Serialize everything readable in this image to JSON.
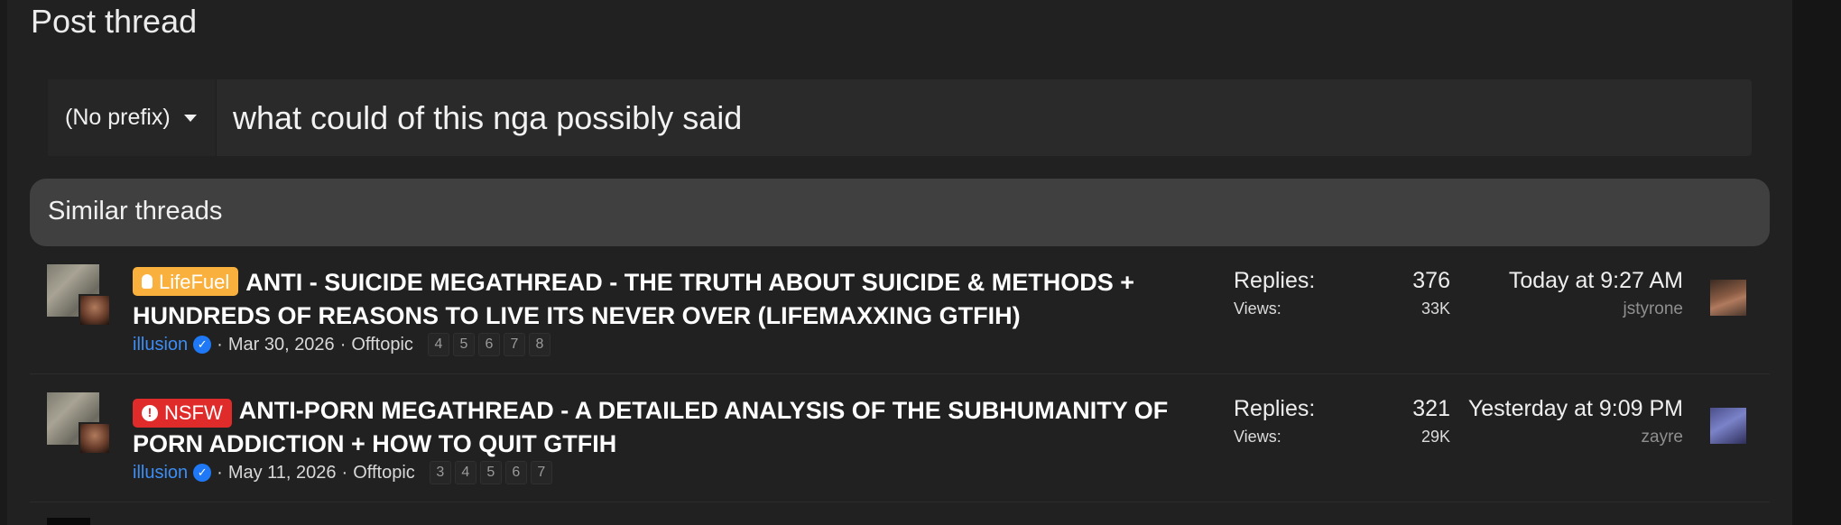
{
  "page": {
    "title": "Post thread"
  },
  "compose": {
    "prefix_label": "(No prefix)",
    "title_value": "what could of this nga possibly said"
  },
  "similar": {
    "heading": "Similar threads",
    "threads": [
      {
        "prefix": {
          "label": "LifeFuel",
          "color": "#f9b03c",
          "icon": "lightbulb-icon"
        },
        "title": "ANTI - SUICIDE MEGATHREAD - THE TRUTH ABOUT SUICIDE & METHODS + HUNDREDS OF REASONS TO LIVE ITS NEVER OVER (LIFEMAXXING GTFIH)",
        "author": "illusion",
        "date": "Mar 30, 2026",
        "forum": "Offtopic",
        "pages": [
          "4",
          "5",
          "6",
          "7",
          "8"
        ],
        "replies_label": "Replies:",
        "replies": "376",
        "views_label": "Views:",
        "views": "33K",
        "last_date": "Today at 9:27 AM",
        "last_user": "jstyrone"
      },
      {
        "prefix": {
          "label": "NSFW",
          "color": "#e02b2b",
          "icon": "alert-icon"
        },
        "title": "ANTI-PORN MEGATHREAD - A DETAILED ANALYSIS OF THE SUBHUMANITY OF PORN ADDICTION + HOW TO QUIT GTFIH",
        "author": "illusion",
        "date": "May 11, 2026",
        "forum": "Offtopic",
        "pages": [
          "3",
          "4",
          "5",
          "6",
          "7"
        ],
        "replies_label": "Replies:",
        "replies": "321",
        "views_label": "Views:",
        "views": "29K",
        "last_date": "Yesterday at 9:09 PM",
        "last_user": "zayre"
      }
    ]
  },
  "separators": {
    "dot": "·"
  }
}
